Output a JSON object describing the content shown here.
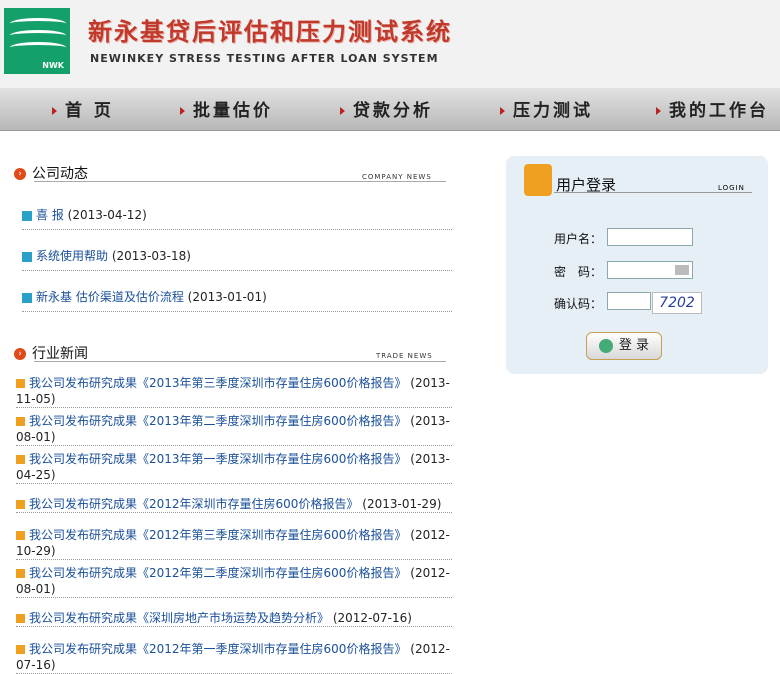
{
  "header": {
    "logo_text": "NWK",
    "title_cn": "新永基贷后评估和压力测试系统",
    "title_en": "NEWINKEY STRESS TESTING AFTER LOAN SYSTEM"
  },
  "nav": [
    {
      "label": "首 页"
    },
    {
      "label": "批量估价"
    },
    {
      "label": "贷款分析"
    },
    {
      "label": "压力测试"
    },
    {
      "label": "我的工作台"
    }
  ],
  "company_news": {
    "title": "公司动态",
    "title_en": "COMPANY NEWS",
    "items": [
      {
        "title": "喜 报",
        "date": "(2013-04-12)"
      },
      {
        "title": "系统使用帮助",
        "date": "(2013-03-18)"
      },
      {
        "title": "新永基 估价渠道及估价流程",
        "date": "(2013-01-01)"
      }
    ]
  },
  "trade_news": {
    "title": "行业新闻",
    "title_en": "TRADE NEWS",
    "items": [
      {
        "title": "我公司发布研究成果《2013年第三季度深圳市存量住房600价格报告》",
        "date": "(2013-11-05)"
      },
      {
        "title": "我公司发布研究成果《2013年第二季度深圳市存量住房600价格报告》",
        "date": "(2013-08-01)"
      },
      {
        "title": "我公司发布研究成果《2013年第一季度深圳市存量住房600价格报告》",
        "date": "(2013-04-25)"
      },
      {
        "title": "我公司发布研究成果《2012年深圳市存量住房600价格报告》",
        "date": "(2013-01-29)"
      },
      {
        "title": "我公司发布研究成果《2012年第三季度深圳市存量住房600价格报告》",
        "date": "(2012-10-29)"
      },
      {
        "title": "我公司发布研究成果《2012年第二季度深圳市存量住房600价格报告》",
        "date": "(2012-08-01)"
      },
      {
        "title": "我公司发布研究成果《深圳房地产市场运势及趋势分析》",
        "date": "(2012-07-16)"
      },
      {
        "title": "我公司发布研究成果《2012年第一季度深圳市存量住房600价格报告》",
        "date": "(2012-07-16)"
      }
    ]
  },
  "login": {
    "title": "用户登录",
    "title_en": "LOGIN",
    "username_label": "用户名：",
    "password_label": "密　码：",
    "captcha_label": "确认码：",
    "captcha_text": "7202",
    "button_label": "登 录"
  }
}
